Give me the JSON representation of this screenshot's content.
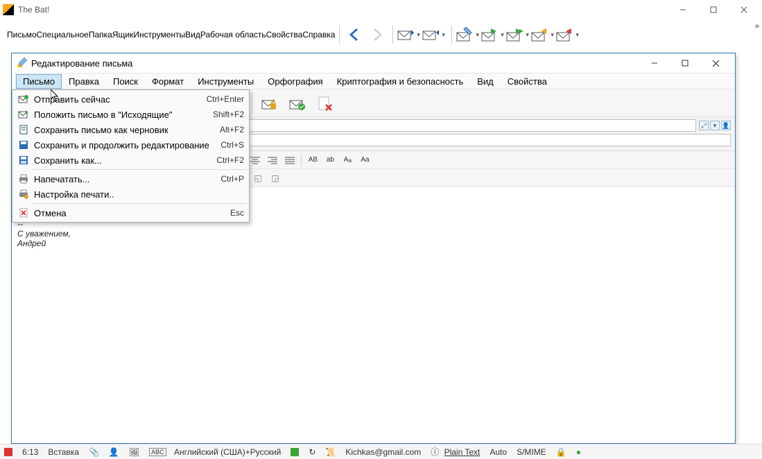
{
  "outer": {
    "app_title": "The Bat!",
    "menu": [
      "Письмо",
      "Специальное",
      "Папка",
      "Ящик",
      "Инструменты",
      "Вид",
      "Рабочая область",
      "Свойства",
      "Справка"
    ]
  },
  "editor": {
    "title": "Редактирование письма",
    "menu": [
      "Письмо",
      "Правка",
      "Поиск",
      "Формат",
      "Инструменты",
      "Орфография",
      "Криптография и безопасность",
      "Вид",
      "Свойства"
    ],
    "active_menu": 0,
    "signature_sep": "--",
    "signature_line1": "С уважением,",
    "signature_line2": "Андрей"
  },
  "dropdown": {
    "items": [
      {
        "label": "Отправить сейчас",
        "shortcut": "Ctrl+Enter",
        "icon": "send"
      },
      {
        "label": "Положить письмо в \"Исходящие\"",
        "shortcut": "Shift+F2",
        "icon": "outbox"
      },
      {
        "label": "Сохранить письмо как черновик",
        "shortcut": "Alt+F2",
        "icon": "draft"
      },
      {
        "label": "Сохранить и продолжить редактирование",
        "shortcut": "Ctrl+S",
        "icon": "save-cont"
      },
      {
        "label": "Сохранить как...",
        "shortcut": "Ctrl+F2",
        "icon": "save-as"
      },
      {
        "sep": true
      },
      {
        "label": "Напечатать...",
        "shortcut": "Ctrl+P",
        "icon": "print"
      },
      {
        "label": "Настройка печати..",
        "shortcut": "",
        "icon": "print-setup"
      },
      {
        "sep": true
      },
      {
        "label": "Отмена",
        "shortcut": "Esc",
        "icon": "cancel"
      }
    ]
  },
  "status": {
    "cursor_pos": "6:13",
    "insert_mode": "Вставка",
    "language": "Английский (США)+Русский",
    "account": "Kichkas@gmail.com",
    "format": "Plain Text",
    "enc": "Auto",
    "smime": "S/MIME"
  }
}
